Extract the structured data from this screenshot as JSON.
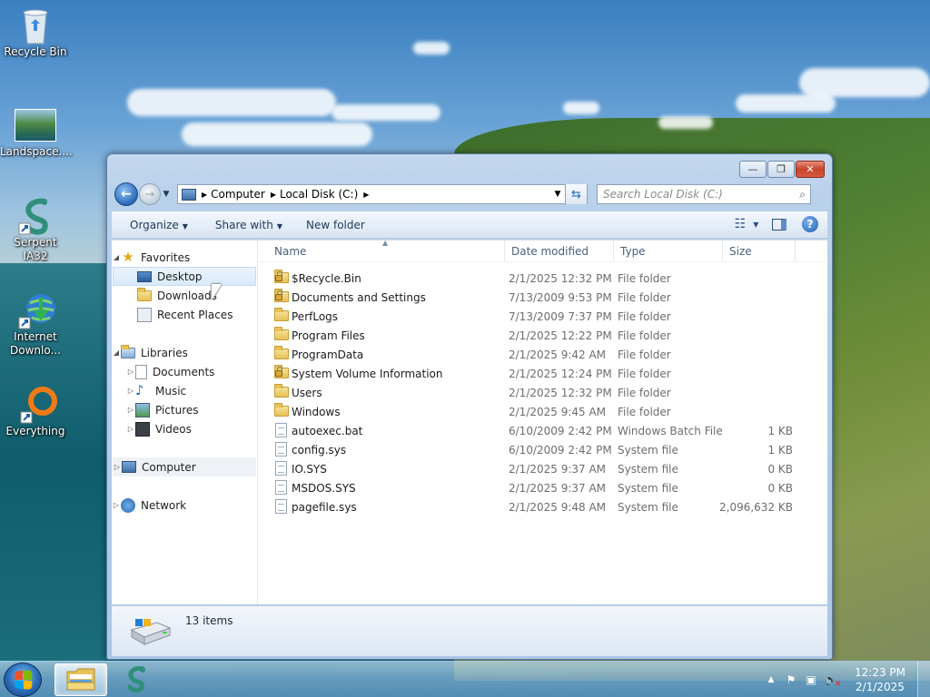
{
  "desktop": {
    "icons": [
      {
        "label": "Recycle Bin",
        "icon": "recycle-bin-icon"
      },
      {
        "label": "Landspace....",
        "icon": "landscape-image-icon"
      },
      {
        "label": "Serpent IA32",
        "icon": "serpent-icon"
      },
      {
        "label": "Internet Downlo...",
        "icon": "internet-download-icon"
      },
      {
        "label": "Everything",
        "icon": "everything-search-icon"
      }
    ]
  },
  "window": {
    "controls": {
      "minimize": "—",
      "maximize": "❐",
      "close": "✕"
    },
    "address": {
      "crumbs": [
        "Computer",
        "Local Disk (C:)"
      ]
    },
    "search": {
      "placeholder": "Search Local Disk (C:)"
    },
    "toolbar": {
      "organize": "Organize",
      "share_with": "Share with",
      "new_folder": "New folder"
    },
    "nav_pane": {
      "favorites": {
        "label": "Favorites",
        "items": [
          "Desktop",
          "Downloads",
          "Recent Places"
        ]
      },
      "libraries": {
        "label": "Libraries",
        "items": [
          "Documents",
          "Music",
          "Pictures",
          "Videos"
        ]
      },
      "computer": "Computer",
      "network": "Network"
    },
    "columns": {
      "name": "Name",
      "date_modified": "Date modified",
      "type": "Type",
      "size": "Size"
    },
    "files": [
      {
        "name": "$Recycle.Bin",
        "date": "2/1/2025 12:32 PM",
        "type": "File folder",
        "size": "",
        "kind": "locked-folder"
      },
      {
        "name": "Documents and Settings",
        "date": "7/13/2009 9:53 PM",
        "type": "File folder",
        "size": "",
        "kind": "locked-folder"
      },
      {
        "name": "PerfLogs",
        "date": "7/13/2009 7:37 PM",
        "type": "File folder",
        "size": "",
        "kind": "folder"
      },
      {
        "name": "Program Files",
        "date": "2/1/2025 12:22 PM",
        "type": "File folder",
        "size": "",
        "kind": "folder"
      },
      {
        "name": "ProgramData",
        "date": "2/1/2025 9:42 AM",
        "type": "File folder",
        "size": "",
        "kind": "folder"
      },
      {
        "name": "System Volume Information",
        "date": "2/1/2025 12:24 PM",
        "type": "File folder",
        "size": "",
        "kind": "locked-folder"
      },
      {
        "name": "Users",
        "date": "2/1/2025 12:32 PM",
        "type": "File folder",
        "size": "",
        "kind": "folder"
      },
      {
        "name": "Windows",
        "date": "2/1/2025 9:45 AM",
        "type": "File folder",
        "size": "",
        "kind": "folder"
      },
      {
        "name": "autoexec.bat",
        "date": "6/10/2009 2:42 PM",
        "type": "Windows Batch File",
        "size": "1 KB",
        "kind": "file"
      },
      {
        "name": "config.sys",
        "date": "6/10/2009 2:42 PM",
        "type": "System file",
        "size": "1 KB",
        "kind": "file"
      },
      {
        "name": "IO.SYS",
        "date": "2/1/2025 9:37 AM",
        "type": "System file",
        "size": "0 KB",
        "kind": "file"
      },
      {
        "name": "MSDOS.SYS",
        "date": "2/1/2025 9:37 AM",
        "type": "System file",
        "size": "0 KB",
        "kind": "file"
      },
      {
        "name": "pagefile.sys",
        "date": "2/1/2025 9:48 AM",
        "type": "System file",
        "size": "2,096,632 KB",
        "kind": "file"
      }
    ],
    "status": {
      "item_count": "13 items"
    }
  },
  "taskbar": {
    "clock_time": "12:23 PM",
    "clock_date": "2/1/2025",
    "colors": {
      "accent": "#2a6cb8"
    }
  }
}
